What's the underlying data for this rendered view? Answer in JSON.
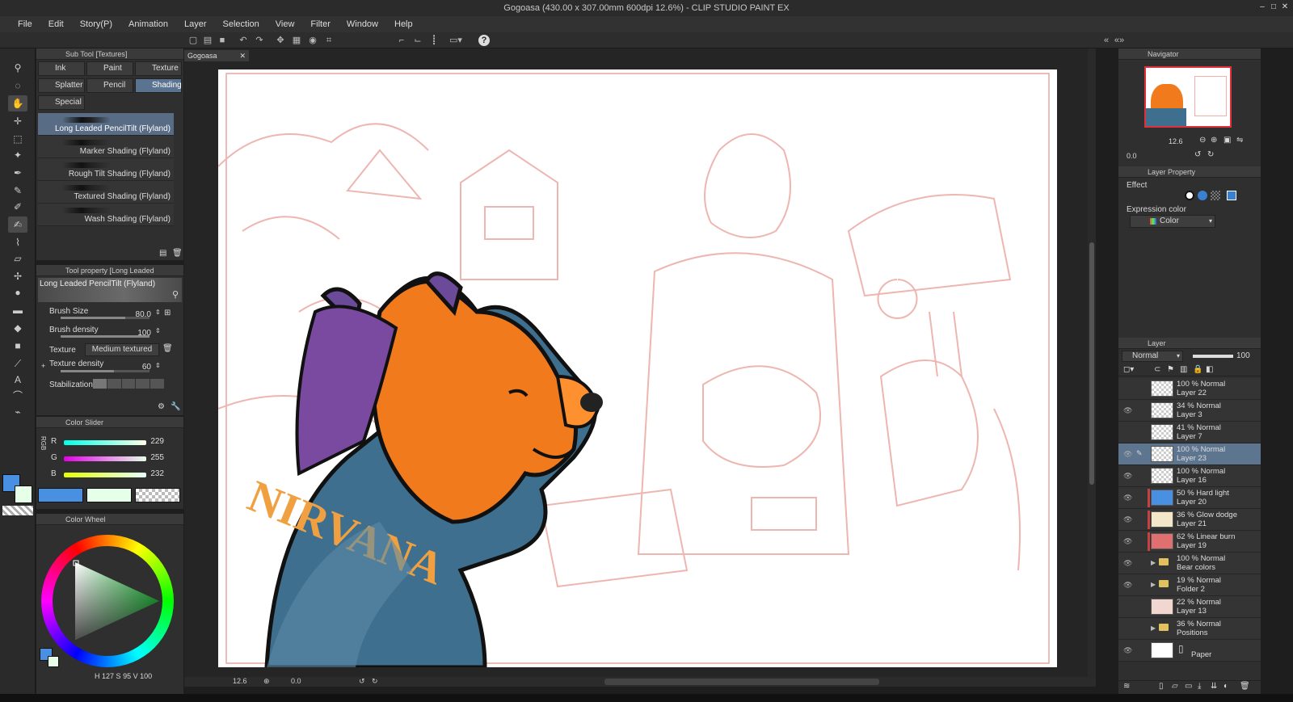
{
  "window": {
    "title": "Gogoasa (430.00 x 307.00mm 600dpi 12.6%) - CLIP STUDIO PAINT EX"
  },
  "menu": [
    "File",
    "Edit",
    "Story(P)",
    "Animation",
    "Layer",
    "Selection",
    "View",
    "Filter",
    "Window",
    "Help"
  ],
  "subtool": {
    "title": "Sub Tool [Textures]",
    "tabs": [
      "Ink",
      "Paint",
      "Texture",
      "Splatter",
      "Pencil",
      "Shading",
      "Special"
    ],
    "active_tab": "Shading",
    "brushes": [
      "Long Leaded PencilTilt (Flyland)",
      "Marker Shading (Flyland)",
      "Rough Tilt Shading  (Flyland)",
      "Textured Shading (Flyland)",
      "Wash Shading (Flyland)"
    ]
  },
  "tool_property": {
    "title": "Tool property [Long Leaded PencilTilt (F",
    "brush_name": "Long Leaded PencilTilt (Flyland)",
    "brush_size_label": "Brush Size",
    "brush_size": "80.0",
    "brush_density_label": "Brush density",
    "brush_density": "100",
    "texture_label": "Texture",
    "texture_value": "Medium textured",
    "texture_density_label": "Texture density",
    "texture_density": "60",
    "stabilization_label": "Stabilization"
  },
  "color_slider": {
    "title": "Color Slider",
    "mode": "RGB",
    "r_label": "R",
    "r": "229",
    "g_label": "G",
    "g": "255",
    "b_label": "B",
    "b": "232"
  },
  "color_wheel": {
    "title": "Color Wheel",
    "h": "127",
    "s": "95",
    "v": "100"
  },
  "document": {
    "tab": "Gogoasa",
    "zoom": "12.6",
    "angle": "0.0",
    "jacket_text": "NIRVANA"
  },
  "navigator": {
    "title": "Navigator",
    "zoom": "12.6",
    "angle": "0.0"
  },
  "layer_property": {
    "title": "Layer Property",
    "effect_label": "Effect",
    "expression_color_label": "Expression color",
    "expression_color_value": "Color"
  },
  "layer_panel": {
    "title": "Layer",
    "blend_mode": "Normal",
    "opacity": "100",
    "layers": [
      {
        "top": "100 %  Normal",
        "name": "Layer 22",
        "visible": false
      },
      {
        "top": "34 %  Normal",
        "name": "Layer 3",
        "visible": true
      },
      {
        "top": "41 %  Normal",
        "name": "Layer 7",
        "visible": false
      },
      {
        "top": "100 %  Normal",
        "name": "Layer 23",
        "visible": true,
        "selected": true
      },
      {
        "top": "100 %  Normal",
        "name": "Layer 16",
        "visible": true
      },
      {
        "top": "50 %  Hard light",
        "name": "Layer 20",
        "visible": true,
        "clip": true
      },
      {
        "top": "36 %  Glow dodge",
        "name": "Layer 21",
        "visible": true,
        "clip": true
      },
      {
        "top": "62 %  Linear burn",
        "name": "Layer 19",
        "visible": true,
        "clip": true
      },
      {
        "top": "100 %  Normal",
        "name": "Bear colors",
        "visible": true,
        "folder": true
      },
      {
        "top": "19 %  Normal",
        "name": "Folder 2",
        "visible": true,
        "folder": true
      },
      {
        "top": "22 %  Normal",
        "name": "Layer 13",
        "visible": false
      },
      {
        "top": "36 %  Normal",
        "name": "Positions",
        "visible": false,
        "folder": true
      },
      {
        "top": "",
        "name": "Paper",
        "visible": true,
        "paper": true
      }
    ]
  },
  "colors": {
    "main": "#4a90e2",
    "sub": "#e5ffe8",
    "accent": "#5e7590",
    "sketch": "#e8a6a0"
  }
}
